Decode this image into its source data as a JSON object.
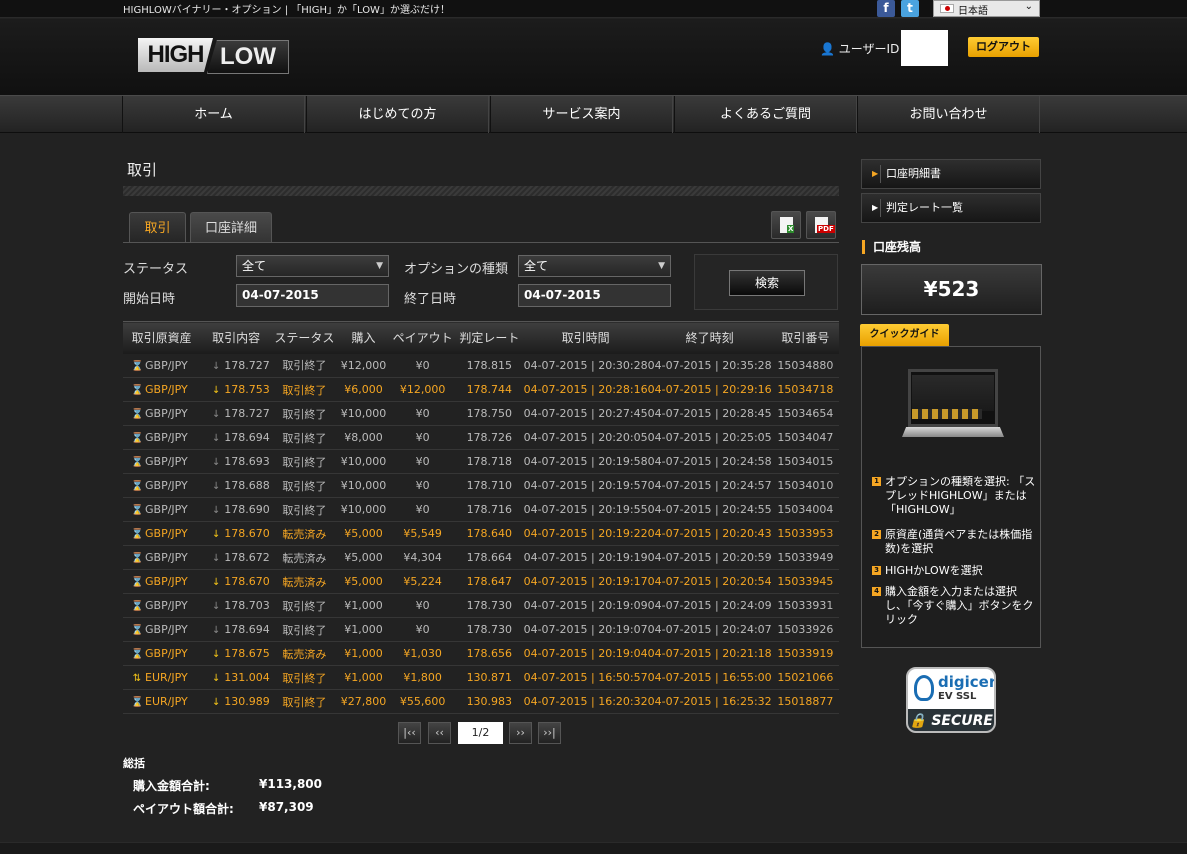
{
  "topbar": {
    "tagline": "HIGHLOWバイナリー・オプション | 「HIGH」か「LOW」か選ぶだけ！",
    "facebook_icon": "f",
    "twitter_icon": "t",
    "language": "日本語"
  },
  "header": {
    "logo_high": "HIGH",
    "logo_low": "LOW",
    "user_label": "ユーザーID：",
    "logout_label": "ログアウト"
  },
  "nav": {
    "items": [
      {
        "label": "ホーム"
      },
      {
        "label": "はじめての方"
      },
      {
        "label": "サービス案内"
      },
      {
        "label": "よくあるご質問"
      },
      {
        "label": "お問い合わせ"
      }
    ]
  },
  "page": {
    "title": "取引",
    "tabs": [
      {
        "label": "取引"
      },
      {
        "label": "口座詳細"
      }
    ],
    "xls_label": "X",
    "pdf_label": "PDF"
  },
  "filters": {
    "status_label": "ステータス",
    "status_value": "全て",
    "option_type_label": "オプションの種類",
    "option_type_value": "全て",
    "start_label": "開始日時",
    "start_value": "04-07-2015",
    "end_label": "終了日時",
    "end_value": "04-07-2015",
    "search_label": "検索"
  },
  "table": {
    "headers": [
      "取引原資産",
      "取引内容",
      "ステータス",
      "購入",
      "ペイアウト",
      "判定レート",
      "取引時間",
      "終了時刻",
      "取引番号"
    ],
    "rows": [
      {
        "hl": false,
        "icon": "⌛",
        "asset": "GBP/JPY",
        "dir": "↓",
        "rate": "178.727",
        "status": "取引終了",
        "buy": "¥12,000",
        "payout": "¥0",
        "judge": "178.815",
        "start": "04-07-2015 | 20:30:28",
        "end": "04-07-2015 | 20:35:28",
        "id": "15034880"
      },
      {
        "hl": true,
        "icon": "⌛",
        "asset": "GBP/JPY",
        "dir": "↓",
        "rate": "178.753",
        "status": "取引終了",
        "buy": "¥6,000",
        "payout": "¥12,000",
        "judge": "178.744",
        "start": "04-07-2015 | 20:28:16",
        "end": "04-07-2015 | 20:29:16",
        "id": "15034718"
      },
      {
        "hl": false,
        "icon": "⌛",
        "asset": "GBP/JPY",
        "dir": "↓",
        "rate": "178.727",
        "status": "取引終了",
        "buy": "¥10,000",
        "payout": "¥0",
        "judge": "178.750",
        "start": "04-07-2015 | 20:27:45",
        "end": "04-07-2015 | 20:28:45",
        "id": "15034654"
      },
      {
        "hl": false,
        "icon": "⌛",
        "asset": "GBP/JPY",
        "dir": "↓",
        "rate": "178.694",
        "status": "取引終了",
        "buy": "¥8,000",
        "payout": "¥0",
        "judge": "178.726",
        "start": "04-07-2015 | 20:20:05",
        "end": "04-07-2015 | 20:25:05",
        "id": "15034047"
      },
      {
        "hl": false,
        "icon": "⌛",
        "asset": "GBP/JPY",
        "dir": "↓",
        "rate": "178.693",
        "status": "取引終了",
        "buy": "¥10,000",
        "payout": "¥0",
        "judge": "178.718",
        "start": "04-07-2015 | 20:19:58",
        "end": "04-07-2015 | 20:24:58",
        "id": "15034015"
      },
      {
        "hl": false,
        "icon": "⌛",
        "asset": "GBP/JPY",
        "dir": "↓",
        "rate": "178.688",
        "status": "取引終了",
        "buy": "¥10,000",
        "payout": "¥0",
        "judge": "178.710",
        "start": "04-07-2015 | 20:19:57",
        "end": "04-07-2015 | 20:24:57",
        "id": "15034010"
      },
      {
        "hl": false,
        "icon": "⌛",
        "asset": "GBP/JPY",
        "dir": "↓",
        "rate": "178.690",
        "status": "取引終了",
        "buy": "¥10,000",
        "payout": "¥0",
        "judge": "178.716",
        "start": "04-07-2015 | 20:19:55",
        "end": "04-07-2015 | 20:24:55",
        "id": "15034004"
      },
      {
        "hl": true,
        "icon": "⌛",
        "asset": "GBP/JPY",
        "dir": "↓",
        "rate": "178.670",
        "status": "転売済み",
        "buy": "¥5,000",
        "payout": "¥5,549",
        "judge": "178.640",
        "start": "04-07-2015 | 20:19:22",
        "end": "04-07-2015 | 20:20:43",
        "id": "15033953"
      },
      {
        "hl": false,
        "icon": "⌛",
        "asset": "GBP/JPY",
        "dir": "↓",
        "rate": "178.672",
        "status": "転売済み",
        "buy": "¥5,000",
        "payout": "¥4,304",
        "judge": "178.664",
        "start": "04-07-2015 | 20:19:19",
        "end": "04-07-2015 | 20:20:59",
        "id": "15033949"
      },
      {
        "hl": true,
        "icon": "⌛",
        "asset": "GBP/JPY",
        "dir": "↓",
        "rate": "178.670",
        "status": "転売済み",
        "buy": "¥5,000",
        "payout": "¥5,224",
        "judge": "178.647",
        "start": "04-07-2015 | 20:19:17",
        "end": "04-07-2015 | 20:20:54",
        "id": "15033945"
      },
      {
        "hl": false,
        "icon": "⌛",
        "asset": "GBP/JPY",
        "dir": "↓",
        "rate": "178.703",
        "status": "取引終了",
        "buy": "¥1,000",
        "payout": "¥0",
        "judge": "178.730",
        "start": "04-07-2015 | 20:19:09",
        "end": "04-07-2015 | 20:24:09",
        "id": "15033931"
      },
      {
        "hl": false,
        "icon": "⌛",
        "asset": "GBP/JPY",
        "dir": "↓",
        "rate": "178.694",
        "status": "取引終了",
        "buy": "¥1,000",
        "payout": "¥0",
        "judge": "178.730",
        "start": "04-07-2015 | 20:19:07",
        "end": "04-07-2015 | 20:24:07",
        "id": "15033926"
      },
      {
        "hl": true,
        "icon": "⌛",
        "asset": "GBP/JPY",
        "dir": "↓",
        "rate": "178.675",
        "status": "転売済み",
        "buy": "¥1,000",
        "payout": "¥1,030",
        "judge": "178.656",
        "start": "04-07-2015 | 20:19:04",
        "end": "04-07-2015 | 20:21:18",
        "id": "15033919"
      },
      {
        "hl": true,
        "icon": "⇅",
        "asset": "EUR/JPY",
        "dir": "↓",
        "rate": "131.004",
        "status": "取引終了",
        "buy": "¥1,000",
        "payout": "¥1,800",
        "judge": "130.871",
        "start": "04-07-2015 | 16:50:57",
        "end": "04-07-2015 | 16:55:00",
        "id": "15021066"
      },
      {
        "hl": true,
        "icon": "⌛",
        "asset": "EUR/JPY",
        "dir": "↓",
        "rate": "130.989",
        "status": "取引終了",
        "buy": "¥27,800",
        "payout": "¥55,600",
        "judge": "130.983",
        "start": "04-07-2015 | 16:20:32",
        "end": "04-07-2015 | 16:25:32",
        "id": "15018877"
      }
    ]
  },
  "pager": {
    "first": "|‹‹",
    "prev": "‹‹",
    "page": "1/2",
    "next": "››",
    "last": "››|"
  },
  "summary": {
    "title": "総括",
    "purchase_label": "購入金額合計:",
    "purchase_value": "¥113,800",
    "payout_label": "ペイアウト額合計:",
    "payout_value": "¥87,309"
  },
  "sidebar": {
    "items": [
      {
        "label": "口座明細書"
      },
      {
        "label": "判定レート一覧"
      }
    ],
    "balance_title": "口座残高",
    "balance_value": "¥523",
    "quick_guide_label": "クイックガイド",
    "steps": [
      {
        "num": "1",
        "text": "オプションの種類を選択: 「スプレッドHIGHLOW」または「HIGHLOW」"
      },
      {
        "num": "2",
        "text": "原資産(通貨ペアまたは株価指数)を選択"
      },
      {
        "num": "3",
        "text": "HIGHかLOWを選択"
      },
      {
        "num": "4",
        "text": "購入金額を入力または選択し、「今すぐ購入」ボタンをクリック"
      }
    ],
    "badge_brand": "digicert",
    "badge_type": "EV SSL",
    "badge_secure": "🔒 SECURE"
  }
}
